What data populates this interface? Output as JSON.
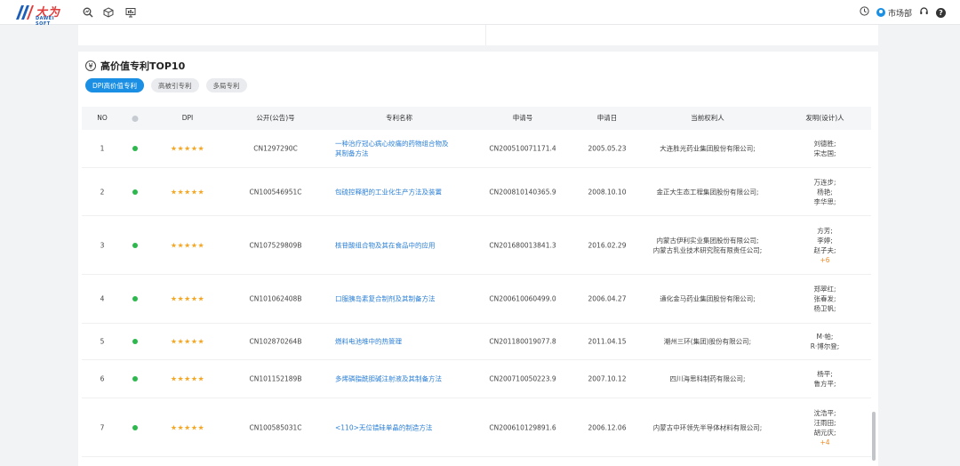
{
  "app": {
    "logo_name": "大为",
    "logo_sub": "DAWEI SOFT"
  },
  "header": {
    "icons": [
      "search-analytics-icon",
      "cube-icon",
      "monitor-icon"
    ],
    "right": {
      "clock_icon": "clock-icon",
      "user_label": "市场部",
      "headset_icon": "headset-icon",
      "help_icon": "help-icon",
      "help_glyph": "?"
    }
  },
  "section": {
    "title": "高价值专利TOP10",
    "title_icon": "yen-icon",
    "yen_glyph": "¥",
    "tabs": [
      {
        "label": "DPI高价值专利",
        "active": true
      },
      {
        "label": "高被引专利",
        "active": false
      },
      {
        "label": "多局专利",
        "active": false
      }
    ]
  },
  "table": {
    "headers": {
      "no": "NO",
      "dpi": "DPI",
      "pub_no": "公开(公告)号",
      "title": "专利名称",
      "app_no": "申请号",
      "app_date": "申请日",
      "holder": "当前权利人",
      "inventor": "发明(设计)人"
    },
    "stars": "★★★★★",
    "status_color": "#2db84d",
    "rows": [
      {
        "no": "1",
        "dpi_stars": 5,
        "pub_no": "CN1297290C",
        "title": "一种治疗冠心病心绞痛的药物组合物及其制备方法",
        "app_no": "CN200510071171.4",
        "app_date": "2005.05.23",
        "holder": [
          "大连胜光药业集团股份有限公司;"
        ],
        "inventors": [
          "刘德胜;",
          "宋志国;"
        ],
        "more": ""
      },
      {
        "no": "2",
        "dpi_stars": 5,
        "pub_no": "CN100546951C",
        "title": "包硫控释肥的工业化生产方法及装置",
        "app_no": "CN200810140365.9",
        "app_date": "2008.10.10",
        "holder": [
          "金正大生态工程集团股份有限公司;"
        ],
        "inventors": [
          "万连步;",
          "杨艳;",
          "李华思;"
        ],
        "more": ""
      },
      {
        "no": "3",
        "dpi_stars": 5,
        "pub_no": "CN107529809B",
        "title": "核苷酸组合物及其在食品中的应用",
        "app_no": "CN201680013841.3",
        "app_date": "2016.02.29",
        "holder": [
          "内蒙古伊利实业集团股份有限公司;",
          "内蒙古乳业技术研究院有限责任公司;"
        ],
        "inventors": [
          "方芳;",
          "李婷;",
          "赵子夫;"
        ],
        "more": "+6"
      },
      {
        "no": "4",
        "dpi_stars": 5,
        "pub_no": "CN101062408B",
        "title": "口服胰岛素复合制剂及其制备方法",
        "app_no": "CN200610060499.0",
        "app_date": "2006.04.27",
        "holder": [
          "通化金马药业集团股份有限公司;"
        ],
        "inventors": [
          "郑翠红;",
          "张春发;",
          "杨卫帆;"
        ],
        "more": ""
      },
      {
        "no": "5",
        "dpi_stars": 5,
        "pub_no": "CN102870264B",
        "title": "燃料电池堆中的热管理",
        "app_no": "CN201180019077.8",
        "app_date": "2011.04.15",
        "holder": [
          "潮州三环(集团)股份有限公司;"
        ],
        "inventors": [
          "M·帕;",
          "R·博尔登;"
        ],
        "more": ""
      },
      {
        "no": "6",
        "dpi_stars": 5,
        "pub_no": "CN101152189B",
        "title": "多烯磷脂酰胆碱注射液及其制备方法",
        "app_no": "CN200710050223.9",
        "app_date": "2007.10.12",
        "holder": [
          "四川海思科制药有限公司;"
        ],
        "inventors": [
          "杨平;",
          "鲁方平;"
        ],
        "more": ""
      },
      {
        "no": "7",
        "dpi_stars": 5,
        "pub_no": "CN100585031C",
        "title": "<110>无位错硅单晶的制造方法",
        "app_no": "CN200610129891.6",
        "app_date": "2006.12.06",
        "holder": [
          "内蒙古中环领先半导体材料有限公司;"
        ],
        "inventors": [
          "沈浩平;",
          "汪雨田;",
          "胡元庆;"
        ],
        "more": "+4"
      }
    ]
  }
}
